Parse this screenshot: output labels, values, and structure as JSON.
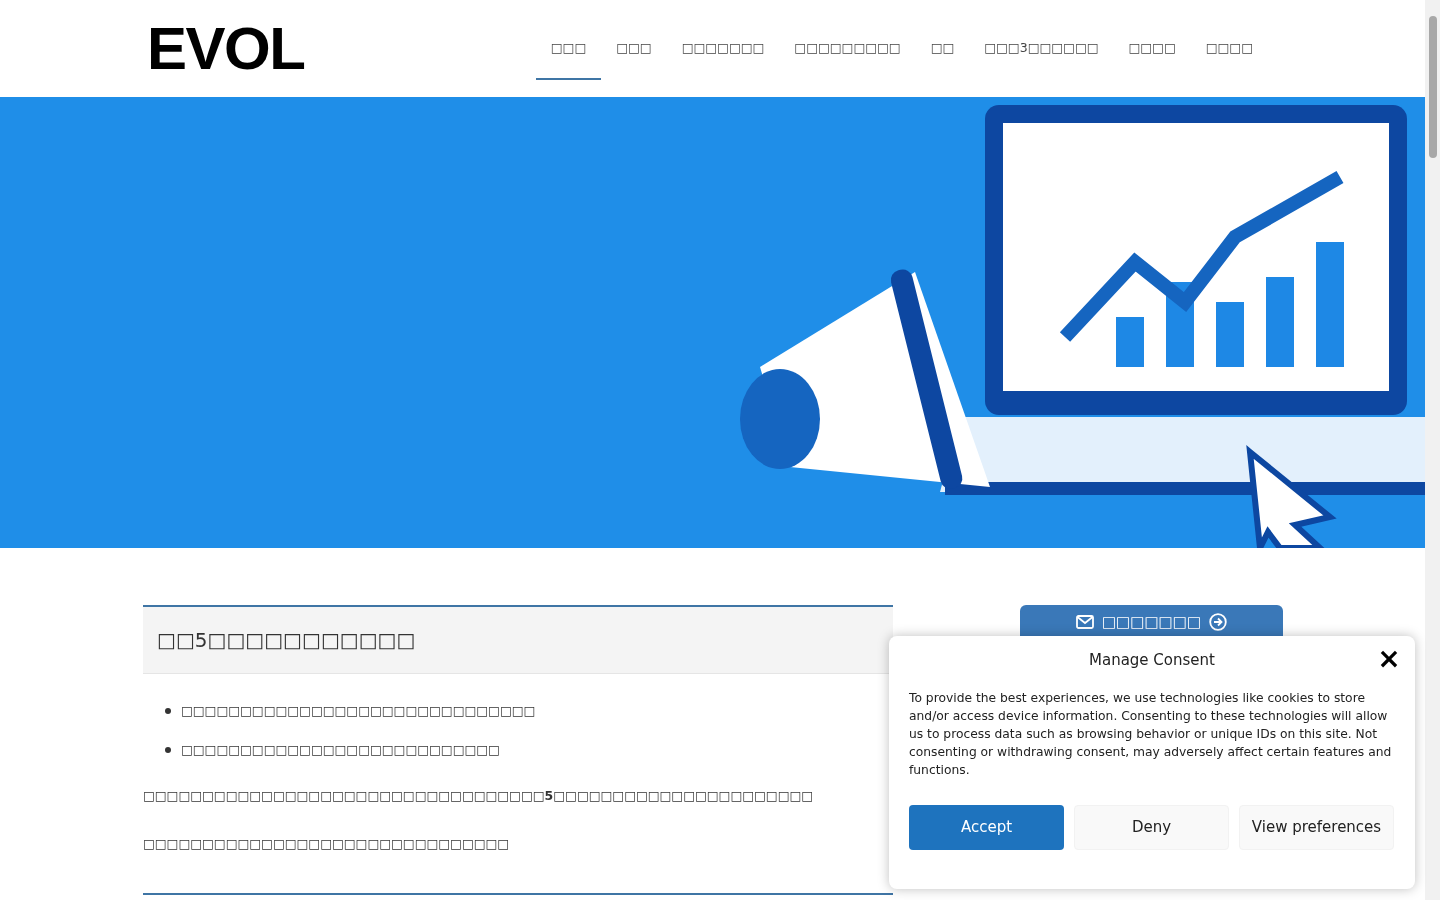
{
  "header": {
    "logo": "EVOL",
    "nav": [
      {
        "label": "□□□",
        "selected": true
      },
      {
        "label": "□□□",
        "selected": false
      },
      {
        "label": "□□□□□□□",
        "selected": false
      },
      {
        "label": "□□□□□□□□□",
        "selected": false
      },
      {
        "label": "□□",
        "selected": false
      },
      {
        "label": "□□□3□□□□□□",
        "selected": false
      },
      {
        "label": "□□□□",
        "selected": false
      },
      {
        "label": "□□□□",
        "selected": false
      }
    ]
  },
  "main": {
    "heading": "□□5□□□□□□□□□□□",
    "bullets": [
      "□□□□□□□□□□□□□□□□□□□□□□□□□□□□□□",
      "□□□□□□□□□□□□□□□□□□□□□□□□□□□"
    ],
    "paragraphs": [
      "□□□□□□□□□□□□□□□□□□□□□□□□□□□□□□□□□□**5**□□□□□□□□□□□□□□□□□□□□□□",
      "□□□□□□□□□□□□□□□□□□□□□□□□□□□□□□□"
    ]
  },
  "sidebar": {
    "contact_button": "□□□□□□□"
  },
  "consent": {
    "title": "Manage Consent",
    "close": "×",
    "text": "To provide the best experiences, we use technologies like cookies to store and/or access device information. Consenting to these technologies will allow us to process data such as browsing behavior or unique IDs on this site. Not consenting or withdrawing consent, may adversely affect certain features and functions.",
    "buttons": [
      {
        "label": "Accept",
        "kind": "primary"
      },
      {
        "label": "Deny",
        "kind": "secondary"
      },
      {
        "label": "View preferences",
        "kind": "secondary"
      }
    ]
  }
}
